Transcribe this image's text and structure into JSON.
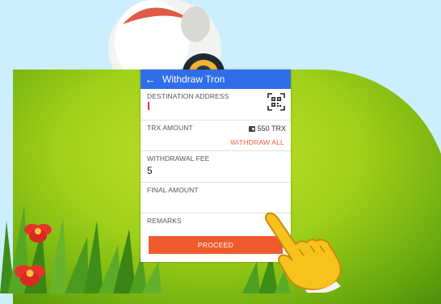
{
  "appbar": {
    "back_icon": "arrow-left-icon",
    "title": "Withdraw Tron"
  },
  "form": {
    "destination": {
      "label": "DESTINATION ADDRESS",
      "value": "",
      "icon": "qr-code-icon"
    },
    "trx_amount": {
      "label": "TRX AMOUNT",
      "balance": "550 TRX",
      "balance_icon": "wallet-icon",
      "withdraw_all": "WITHDRAW ALL"
    },
    "fee": {
      "label": "WITHDRAWAL FEE",
      "value": "5"
    },
    "final_amount": {
      "label": "FINAL AMOUNT",
      "value": ""
    },
    "remarks": {
      "label": "REMARKS",
      "value": ""
    },
    "proceed_label": "PROCEED"
  },
  "colors": {
    "appbar": "#2f6ee8",
    "accent": "#f05b2e",
    "background": "#cdeefd",
    "hill": "#9fd019"
  }
}
